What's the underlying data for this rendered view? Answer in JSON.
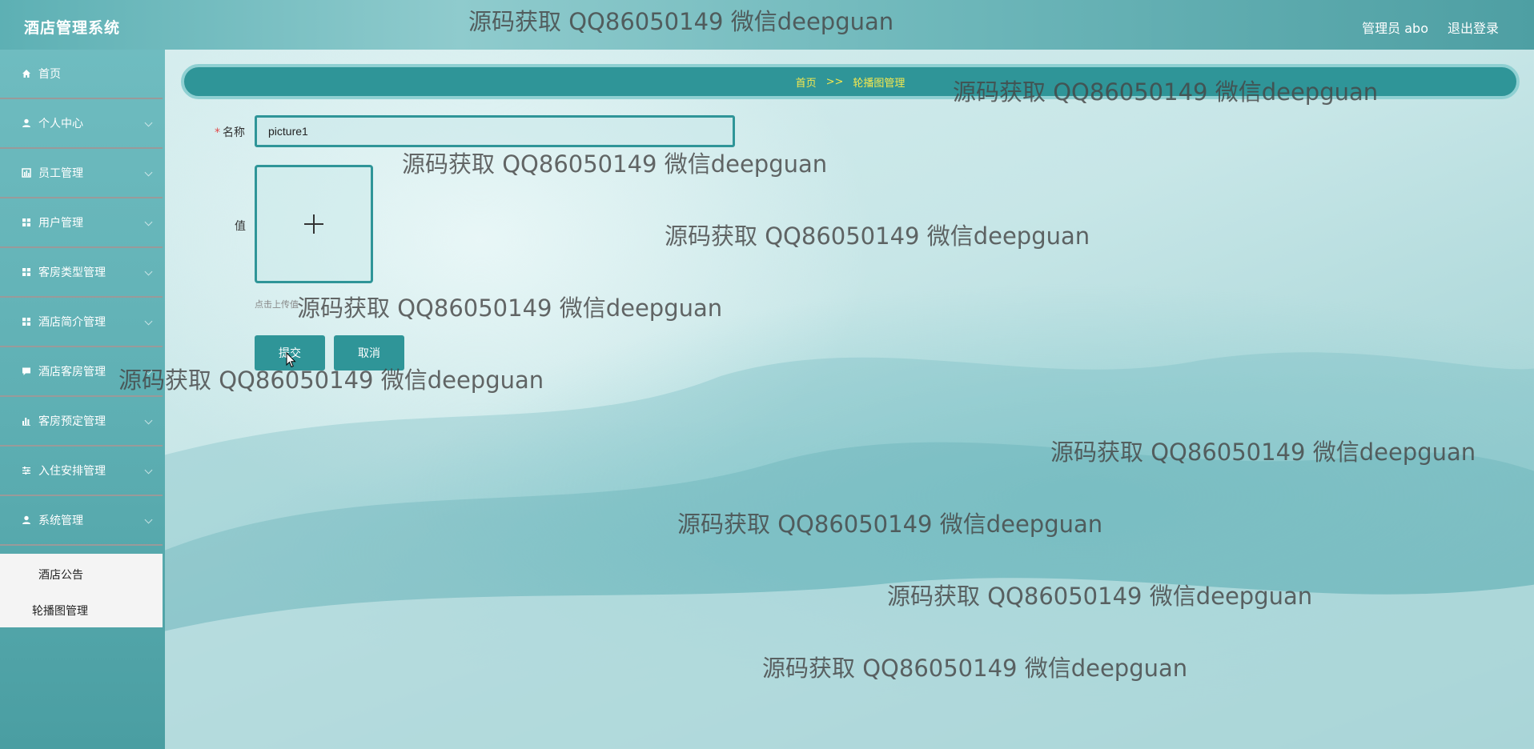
{
  "header": {
    "app_title": "酒店管理系统",
    "user_label": "管理员 abo",
    "logout_label": "退出登录"
  },
  "sidebar": {
    "items": [
      {
        "label": "首页",
        "icon": "home-icon"
      },
      {
        "label": "个人中心",
        "icon": "person-icon"
      },
      {
        "label": "员工管理",
        "icon": "chart-icon"
      },
      {
        "label": "用户管理",
        "icon": "grid-icon"
      },
      {
        "label": "客房类型管理",
        "icon": "grid-icon"
      },
      {
        "label": "酒店简介管理",
        "icon": "grid-icon"
      },
      {
        "label": "酒店客房管理",
        "icon": "comment-icon"
      },
      {
        "label": "客房预定管理",
        "icon": "bar-chart-icon"
      },
      {
        "label": "入住安排管理",
        "icon": "sliders-icon"
      },
      {
        "label": "系统管理",
        "icon": "person-icon"
      }
    ],
    "submenu": [
      {
        "label": "酒店公告"
      },
      {
        "label": "轮播图管理"
      }
    ]
  },
  "breadcrumb": {
    "home": "首页",
    "separator": ">>",
    "current": "轮播图管理"
  },
  "form": {
    "name_label": "名称",
    "name_required_mark": "*",
    "name_value": "picture1",
    "value_label": "值",
    "upload_hint": "点击上传值",
    "submit_label": "提交",
    "cancel_label": "取消"
  },
  "watermark": {
    "text": "源码获取 QQ86050149 微信deepguan"
  },
  "colors": {
    "accent": "#2f9598",
    "breadcrumb_text": "#f5e84e"
  }
}
